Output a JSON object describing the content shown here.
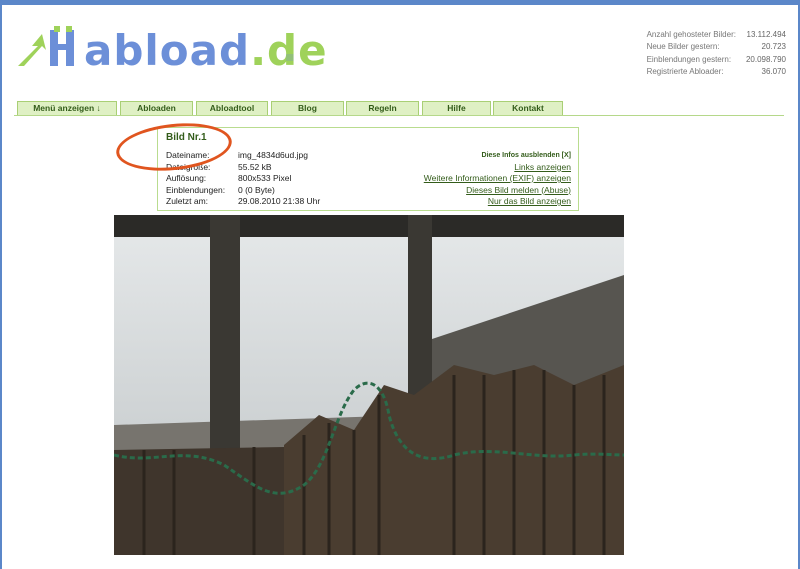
{
  "logo": {
    "name": "abload",
    "tld": ".de"
  },
  "stats": [
    {
      "label": "Anzahl gehosteter Bilder:",
      "value": "13.112.494"
    },
    {
      "label": "Neue Bilder gestern:",
      "value": "20.723"
    },
    {
      "label": "Einblendungen gestern:",
      "value": "20.098.790"
    },
    {
      "label": "Registrierte Abloader:",
      "value": "36.070"
    }
  ],
  "nav": [
    {
      "label": "Menü anzeigen ↓"
    },
    {
      "label": "Abloaden"
    },
    {
      "label": "Abloadtool"
    },
    {
      "label": "Blog"
    },
    {
      "label": "Regeln"
    },
    {
      "label": "Hilfe"
    },
    {
      "label": "Kontakt"
    }
  ],
  "info": {
    "title": "Bild Nr.1",
    "rows": [
      {
        "key": "Dateiname:",
        "value": "img_4834d6ud.jpg"
      },
      {
        "key": "Dateigröße:",
        "value": "55.52 kB"
      },
      {
        "key": "Auflösung:",
        "value": "800x533 Pixel"
      },
      {
        "key": "Einblendungen:",
        "value": "0 (0 Byte)"
      },
      {
        "key": "Zuletzt am:",
        "value": "29.08.2010 21:38 Uhr"
      }
    ],
    "hide_label": "Diese Infos ausblenden [X]",
    "links": [
      "Links anzeigen",
      "Weitere Informationen (EXIF) anzeigen",
      "Dieses Bild melden (Abuse)",
      "Nur das Bild anzeigen"
    ]
  },
  "colors": {
    "frame": "#5b87c9",
    "nav_bg": "#dff0c4",
    "nav_border": "#a9cf75",
    "highlight_circle": "#e0551f"
  }
}
